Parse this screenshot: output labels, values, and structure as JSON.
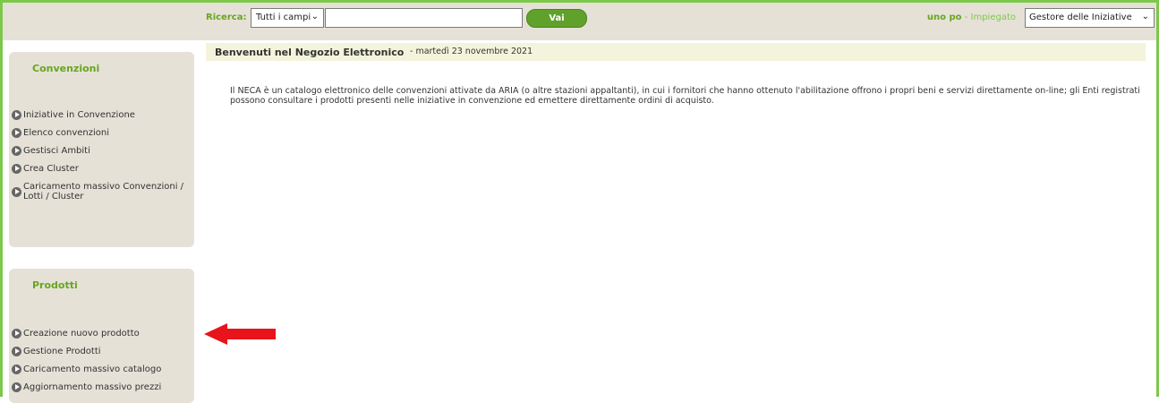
{
  "search": {
    "label": "Ricerca:",
    "scope_selected": "Tutti i campi",
    "query_value": "",
    "submit_label": "Vai"
  },
  "user": {
    "name": "uno po",
    "separator": " - ",
    "role": "Impiegato",
    "profile_selected": "Gestore delle Iniziative"
  },
  "welcome": {
    "title": "Benvenuti nel Negozio Elettronico",
    "date": "- martedì 23 novembre 2021"
  },
  "intro_text": "Il NECA è un catalogo elettronico delle convenzioni attivate da ARIA (o altre stazioni appaltanti), in cui i fornitori che hanno ottenuto l'abilitazione offrono i propri beni e servizi direttamente on-line; gli Enti registrati possono consultare i prodotti presenti nelle iniziative in convenzione ed emettere direttamente ordini di acquisto.",
  "convenzioni": {
    "title": "Convenzioni",
    "items": [
      {
        "label": "Iniziative in Convenzione"
      },
      {
        "label": "Elenco convenzioni"
      },
      {
        "label": "Gestisci Ambiti"
      },
      {
        "label": "Crea Cluster"
      },
      {
        "label": "Caricamento massivo Convenzioni / Lotti / Cluster"
      }
    ]
  },
  "prodotti": {
    "title": "Prodotti",
    "items": [
      {
        "label": "Creazione nuovo prodotto"
      },
      {
        "label": "Gestione Prodotti"
      },
      {
        "label": "Caricamento massivo catalogo"
      },
      {
        "label": "Aggiornamento massivo prezzi"
      }
    ]
  },
  "colors": {
    "frame_green": "#7cc84a",
    "brand_green": "#66a61e",
    "button_green": "#5fa12a",
    "panel_beige": "#e6e1d7",
    "welcome_bg": "#f4f4dc",
    "arrow_red": "#e8131b"
  },
  "icons": {
    "menu_bullet": "play-circle-icon",
    "dropdown": "chevron-down-icon",
    "annotation": "red-arrow-left"
  }
}
